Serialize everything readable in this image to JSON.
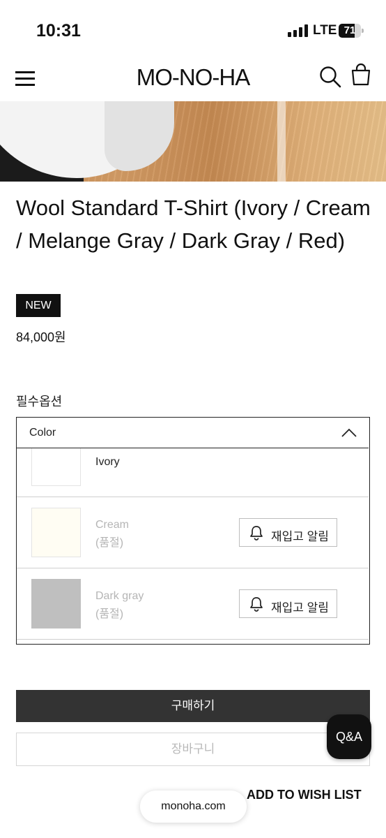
{
  "status_bar": {
    "time": "10:31",
    "network": "LTE",
    "battery": "71",
    "battery_level": 0.71
  },
  "header": {
    "logo": "MO-NO-HA",
    "menu_icon": "hamburger-menu-icon",
    "search_icon": "search-icon",
    "cart_icon": "shopping-bag-icon"
  },
  "product": {
    "title": "Wool Standard T-Shirt (Ivory / Cream / Melange Gray / Dark Gray / Red)",
    "badge": "NEW",
    "price": "84,000원"
  },
  "options": {
    "label": "필수옵션",
    "dropdown_label": "Color",
    "items": [
      {
        "name": "Ivory",
        "status": "",
        "swatch_color": "#ffffff"
      },
      {
        "name": "Cream",
        "status": "(품절)",
        "swatch_color": "#fffdf3",
        "restock_label": "재입고 알림"
      },
      {
        "name": "Dark gray",
        "status": "(품절)",
        "swatch_color": "#bfbfbf",
        "restock_label": "재입고 알림"
      }
    ]
  },
  "actions": {
    "buy": "구매하기",
    "cart": "장바구니",
    "qa": "Q&A",
    "wishlist": "ADD TO WISH LIST"
  },
  "browser": {
    "url": "monoha.com"
  },
  "colors": {
    "buy_button": "#333333",
    "badge": "#111111"
  }
}
